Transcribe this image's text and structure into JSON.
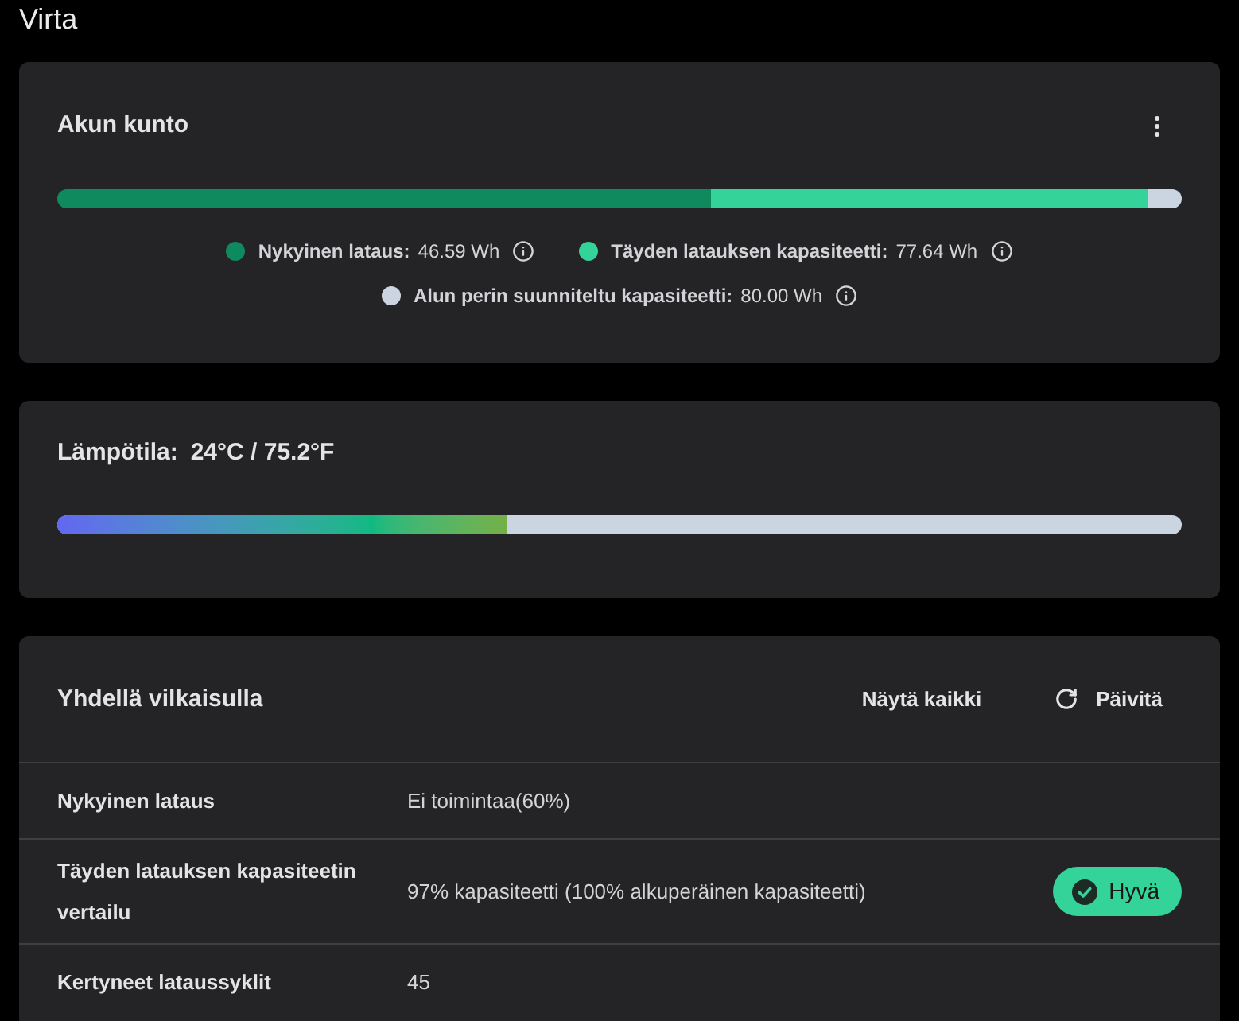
{
  "page_title": "Virta",
  "battery_health": {
    "title": "Akun kunto",
    "legend": [
      {
        "label": "Nykyinen lataus:",
        "value": "46.59 Wh",
        "color": "#0e8a5e",
        "level": 0.582
      },
      {
        "label": "Täyden latauksen kapasiteetti:",
        "value": "77.64 Wh",
        "color": "#34d399",
        "level": 0.97
      },
      {
        "label": "Alun perin suunniteltu kapasiteetti:",
        "value": "80.00 Wh",
        "color": "#cbd5e1",
        "level": 1
      }
    ]
  },
  "temperature": {
    "label": "Lämpötila:",
    "value": "24°C / 75.2°F",
    "level": 0.4
  },
  "at_a_glance": {
    "title": "Yhdellä vilkaisulla",
    "actions": [
      {
        "kind": "link",
        "label": "Näytä kaikki"
      },
      {
        "kind": "refresh",
        "label": "Päivitä"
      }
    ],
    "rows": [
      {
        "label": "Nykyinen lataus",
        "value": "Ei toimintaa(60%)"
      },
      {
        "label": "Täyden latauksen kapasiteetin vertailu",
        "value": "97% kapasiteetti (100% alkuperäinen kapasiteetti)",
        "badge": {
          "kind": "good",
          "label": "Hyvä"
        }
      },
      {
        "label": "Kertyneet lataussyklit",
        "value": "45"
      }
    ]
  }
}
